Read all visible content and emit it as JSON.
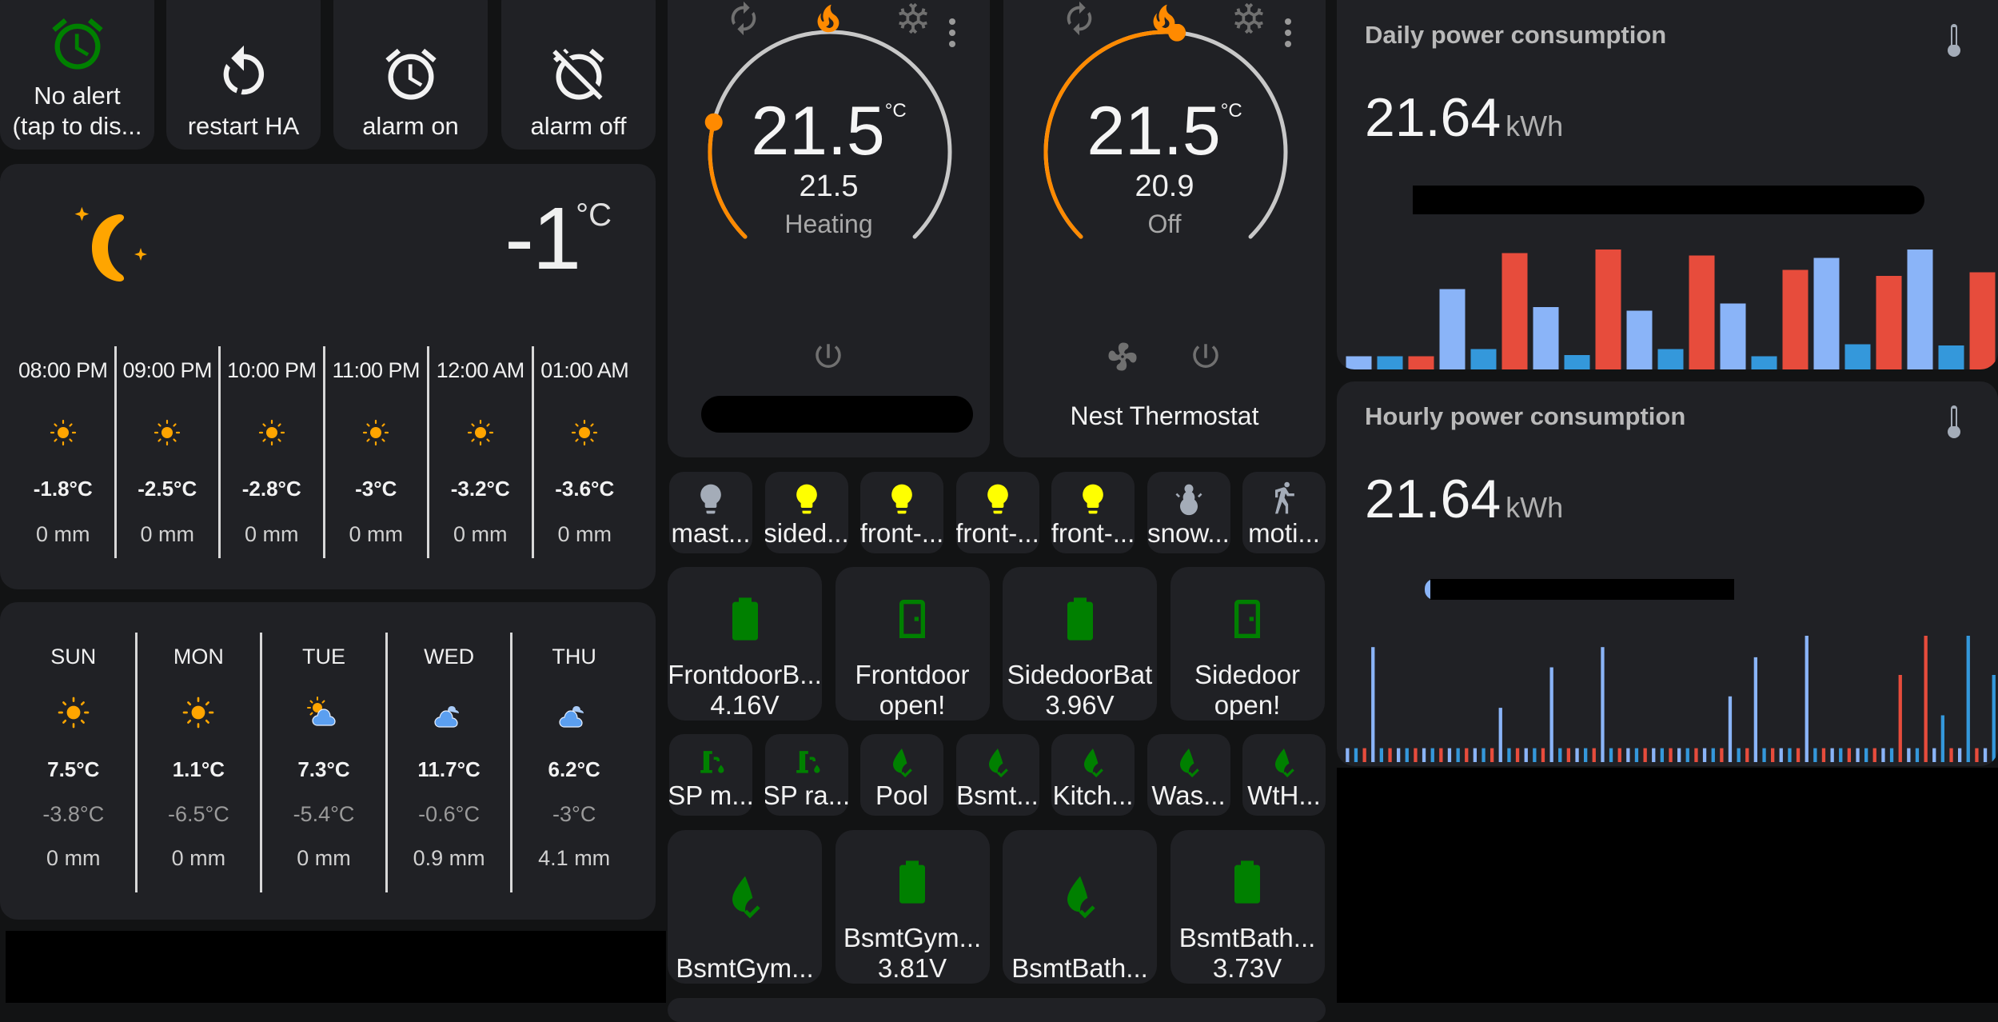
{
  "colors": {
    "background": "#121314",
    "card": "#202125",
    "accent_orange": "#ff8a00",
    "green": "#008000",
    "yellow": "#ffff00",
    "bar_light_blue": "#8ab4f8",
    "bar_blue": "#3498db",
    "bar_red": "#e74c3c"
  },
  "top_buttons": [
    {
      "label": "No alert\n(tap to dis...",
      "icon": "alarm-clock-icon",
      "color": "#008000"
    },
    {
      "label": "restart HA",
      "icon": "restart-icon",
      "color": "#f2f2f2"
    },
    {
      "label": "alarm on",
      "icon": "alarm-icon",
      "color": "#f2f2f2"
    },
    {
      "label": "alarm off",
      "icon": "alarm-off-icon",
      "color": "#f2f2f2"
    }
  ],
  "weather": {
    "current": {
      "icon": "night-clear-icon",
      "temperature": "-1",
      "unit": "°C"
    },
    "hourly": [
      {
        "time": "08:00 PM",
        "icon": "sunny-icon",
        "temp": "-1.8°C",
        "precip": "0 mm"
      },
      {
        "time": "09:00 PM",
        "icon": "sunny-icon",
        "temp": "-2.5°C",
        "precip": "0 mm"
      },
      {
        "time": "10:00 PM",
        "icon": "sunny-icon",
        "temp": "-2.8°C",
        "precip": "0 mm"
      },
      {
        "time": "11:00 PM",
        "icon": "sunny-icon",
        "temp": "-3°C",
        "precip": "0 mm"
      },
      {
        "time": "12:00 AM",
        "icon": "sunny-icon",
        "temp": "-3.2°C",
        "precip": "0 mm"
      },
      {
        "time": "01:00 AM",
        "icon": "sunny-icon",
        "temp": "-3.6°C",
        "precip": "0 mm"
      }
    ],
    "daily": [
      {
        "day": "SUN",
        "icon": "sunny-icon",
        "high": "7.5°C",
        "low": "-3.8°C",
        "precip": "0 mm"
      },
      {
        "day": "MON",
        "icon": "sunny-icon",
        "high": "1.1°C",
        "low": "-6.5°C",
        "precip": "0 mm"
      },
      {
        "day": "TUE",
        "icon": "partly-cloudy-icon",
        "high": "7.3°C",
        "low": "-5.4°C",
        "precip": "0 mm"
      },
      {
        "day": "WED",
        "icon": "cloudy-icon",
        "high": "11.7°C",
        "low": "-0.6°C",
        "precip": "0.9 mm"
      },
      {
        "day": "THU",
        "icon": "cloudy-icon",
        "high": "6.2°C",
        "low": "-3°C",
        "precip": "4.1 mm"
      }
    ]
  },
  "thermostats": [
    {
      "target": "21.5",
      "unit": "°C",
      "current": "21.5",
      "action": "Heating",
      "name": "",
      "setpoint_fraction": 0.22,
      "modes": [
        "auto-icon",
        "heat-icon",
        "cool-icon"
      ],
      "active_mode": "heat-icon",
      "has_fan": false
    },
    {
      "target": "21.5",
      "unit": "°C",
      "current": "20.9",
      "action": "Off",
      "name": "Nest Thermostat",
      "setpoint_fraction": 0.52,
      "modes": [
        "auto-icon",
        "heat-icon",
        "cool-icon"
      ],
      "active_mode": "heat-icon",
      "has_fan": true
    }
  ],
  "light_buttons": [
    {
      "label": "mast...",
      "icon": "lightbulb-icon",
      "state": "off"
    },
    {
      "label": "sided...",
      "icon": "lightbulb-icon",
      "state": "on"
    },
    {
      "label": "front-...",
      "icon": "lightbulb-icon",
      "state": "on"
    },
    {
      "label": "front-...",
      "icon": "lightbulb-icon",
      "state": "on"
    },
    {
      "label": "front-...",
      "icon": "lightbulb-icon",
      "state": "on"
    },
    {
      "label": "snow...",
      "icon": "snowman-icon",
      "state": "off"
    },
    {
      "label": "moti...",
      "icon": "walk-icon",
      "state": "off"
    }
  ],
  "door_sensors": [
    {
      "label": "FrontdoorB...",
      "value": "4.16V",
      "icon": "battery-icon"
    },
    {
      "label": "Frontdoor",
      "value": "open!",
      "icon": "door-icon"
    },
    {
      "label": "SidedoorBat",
      "value": "3.96V",
      "icon": "battery-icon"
    },
    {
      "label": "Sidedoor",
      "value": "open!",
      "icon": "door-icon"
    }
  ],
  "water_buttons": [
    {
      "label": "SP m...",
      "icon": "water-pump-icon"
    },
    {
      "label": "SP ra...",
      "icon": "water-pump-icon"
    },
    {
      "label": "Pool",
      "icon": "water-check-icon"
    },
    {
      "label": "Bsmt...",
      "icon": "water-check-icon"
    },
    {
      "label": "Kitch...",
      "icon": "water-check-icon"
    },
    {
      "label": "Was...",
      "icon": "water-check-icon"
    },
    {
      "label": "WtH...",
      "icon": "water-check-icon"
    }
  ],
  "basement_sensors": [
    {
      "label": "BsmtGym...",
      "value": "",
      "icon": "water-check-icon"
    },
    {
      "label": "BsmtGym...",
      "value": "3.81V",
      "icon": "battery-icon"
    },
    {
      "label": "BsmtBath...",
      "value": "",
      "icon": "water-check-icon"
    },
    {
      "label": "BsmtBath...",
      "value": "3.73V",
      "icon": "battery-icon"
    }
  ],
  "power": {
    "daily": {
      "title": "Daily power consumption",
      "value": "21.64",
      "unit": "kWh",
      "icon": "thermometer-icon"
    },
    "hourly": {
      "title": "Hourly power consumption",
      "value": "21.64",
      "unit": "kWh",
      "icon": "thermometer-icon"
    }
  },
  "chart_data": [
    {
      "type": "bar",
      "title": "Daily power consumption",
      "xlabel": "",
      "ylabel": "",
      "ylim": [
        0,
        100
      ],
      "grid": false,
      "legend": "none",
      "colors_cycle": [
        "#8ab4f8",
        "#3498db",
        "#e74c3c"
      ],
      "values": [
        11,
        11,
        11,
        67,
        17,
        97,
        52,
        12,
        100,
        49,
        17,
        95,
        55,
        11,
        83,
        93,
        21,
        78,
        100,
        20,
        81
      ]
    },
    {
      "type": "bar",
      "title": "Hourly power consumption",
      "xlabel": "",
      "ylabel": "",
      "ylim": [
        0,
        100
      ],
      "grid": false,
      "legend": "none",
      "colors_cycle": [
        "#8ab4f8",
        "#3498db",
        "#e74c3c"
      ],
      "values": [
        11,
        11,
        11,
        91,
        11,
        11,
        11,
        11,
        11,
        11,
        11,
        11,
        11,
        11,
        11,
        11,
        11,
        11,
        43,
        11,
        11,
        11,
        11,
        11,
        75,
        11,
        11,
        11,
        11,
        11,
        91,
        11,
        11,
        11,
        11,
        11,
        11,
        11,
        11,
        11,
        11,
        11,
        11,
        11,
        11,
        52,
        11,
        11,
        83,
        11,
        11,
        11,
        11,
        11,
        100,
        11,
        11,
        11,
        11,
        11,
        11,
        11,
        11,
        11,
        11,
        69,
        11,
        11,
        100,
        11,
        37,
        11,
        11,
        100,
        11,
        11,
        69
      ]
    }
  ]
}
